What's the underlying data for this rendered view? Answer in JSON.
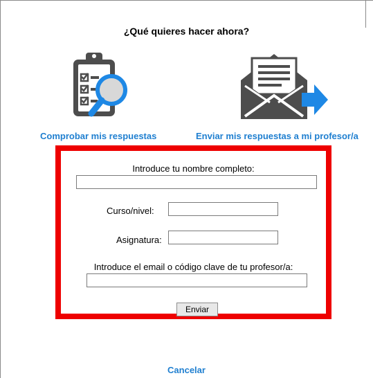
{
  "dialog": {
    "title": "¿Qué quieres hacer ahora?"
  },
  "options": {
    "check": {
      "label": "Comprobar mis respuestas",
      "icon": "clipboard-magnifier-icon"
    },
    "send": {
      "label": "Enviar mis respuestas a mi profesor/a",
      "icon": "envelope-send-icon"
    }
  },
  "form": {
    "name_label": "Introduce tu nombre completo:",
    "name_value": "",
    "course_label": "Curso/nivel:",
    "course_value": "",
    "subject_label": "Asignatura:",
    "subject_value": "",
    "email_label": "Introduce el email o código clave de tu profesor/a:",
    "email_value": "",
    "submit_label": "Enviar"
  },
  "footer": {
    "cancel_label": "Cancelar"
  },
  "colors": {
    "link": "#1f7fd0",
    "highlight_border": "#ee0000",
    "icon_gray": "#4d4d4d",
    "icon_blue": "#1e88e5"
  }
}
